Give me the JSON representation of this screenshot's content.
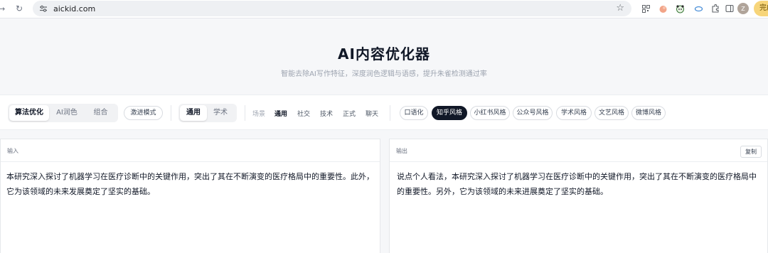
{
  "browser": {
    "url": "aickid.com",
    "profile_initial": "Z",
    "finish_label": "完成"
  },
  "header": {
    "title": "AI内容优化器",
    "subtitle": "智能去除AI写作特征，深度润色逻辑与语感，提升朱雀检测通过率"
  },
  "toolbar": {
    "mode_tabs": [
      {
        "label": "算法优化",
        "active": true
      },
      {
        "label": "AI润色",
        "active": false
      },
      {
        "label": "组合",
        "active": false
      }
    ],
    "aggressive_label": "激进模式",
    "domain_tabs": [
      {
        "label": "通用",
        "active": true
      },
      {
        "label": "学术",
        "active": false
      }
    ],
    "scene_label": "场景",
    "scenes": [
      {
        "label": "通用",
        "active": true
      },
      {
        "label": "社交",
        "active": false
      },
      {
        "label": "技术",
        "active": false
      },
      {
        "label": "正式",
        "active": false
      },
      {
        "label": "聊天",
        "active": false
      }
    ],
    "styles": [
      {
        "label": "口语化",
        "active": false
      },
      {
        "label": "知乎风格",
        "active": true
      },
      {
        "label": "小红书风格",
        "active": false
      },
      {
        "label": "公众号风格",
        "active": false
      },
      {
        "label": "学术风格",
        "active": false
      },
      {
        "label": "文艺风格",
        "active": false
      },
      {
        "label": "微博风格",
        "active": false
      }
    ]
  },
  "input_panel": {
    "label": "输入",
    "text": "本研究深入探讨了机器学习在医疗诊断中的关键作用，突出了其在不断演变的医疗格局中的重要性。此外，它为该领域的未来发展奠定了坚实的基础。"
  },
  "output_panel": {
    "label": "输出",
    "copy_label": "复制",
    "text": "说点个人看法，本研究深入探讨了机器学习在医疗诊断中的关键作用，突出了其在不断演变的医疗格局中的重要性。另外，它为该领域的未来进展奠定了坚实的基础。"
  },
  "colors": {
    "accent_dark": "#111827",
    "finish_pill": "#f7d57a"
  }
}
